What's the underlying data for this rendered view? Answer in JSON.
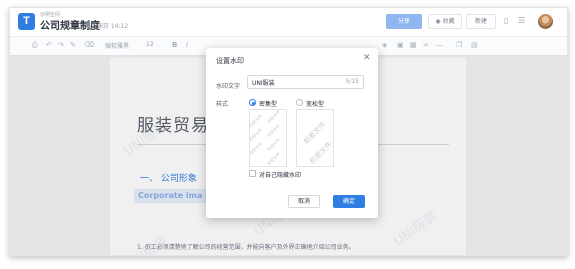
{
  "header": {
    "workspace": "示例空间",
    "doc_title": "公司规章制度",
    "save_status": "最近保存 14:12",
    "share_label": "分享",
    "collect_label": "收藏",
    "new_label": "新建"
  },
  "toolbar": {
    "font_family": "微软雅黑",
    "font_size": "12"
  },
  "document": {
    "heading": "服装贸易",
    "section_title": "一、 公司形象",
    "section_title_en": "Corporate ima",
    "paragraph": "1. 员工必须清楚地了解公司的经营范围，并能向客户及外界正确地介绍公司业务。",
    "watermark_text": "UNI服装"
  },
  "dialog": {
    "title": "设置水印",
    "watermark_text_label": "水印文字",
    "watermark_value": "UNI服装",
    "char_count": "5/15",
    "style_label": "样式",
    "style_dense": "密集型",
    "style_loose": "宽松型",
    "selected_style": "密集型",
    "preview_dense_text": "机密文件",
    "preview_loose_text": "机密文件",
    "hide_for_self_label": "对自己隐藏水印",
    "hide_for_self_checked": false,
    "cancel_label": "取消",
    "confirm_label": "确定"
  },
  "colors": {
    "accent": "#2f7de1",
    "share_button": "#8fb6ee"
  }
}
